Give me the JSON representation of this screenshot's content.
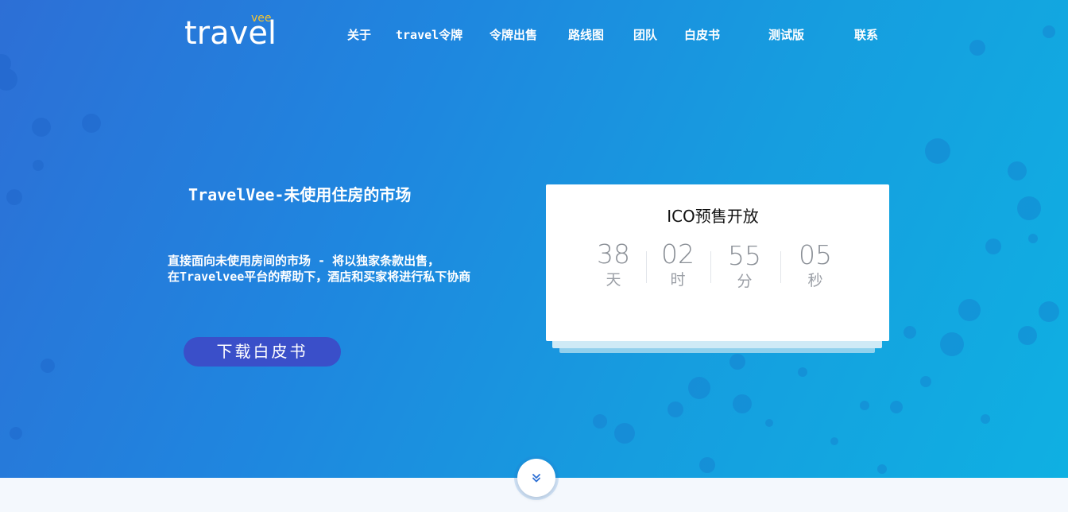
{
  "brand": {
    "logo_main": "travel",
    "logo_sub": "vee"
  },
  "nav": {
    "items": [
      {
        "label": "关于"
      },
      {
        "label": "travel令牌"
      },
      {
        "label": "令牌出售"
      },
      {
        "label": "路线图"
      },
      {
        "label": "团队"
      },
      {
        "label": "白皮书"
      },
      {
        "label": "测试版"
      },
      {
        "label": "联系"
      }
    ]
  },
  "hero": {
    "title": "TravelVee-未使用住房的市场",
    "description_line1": "直接面向未使用房间的市场 - 将以独家条款出售，",
    "description_line2": "在Travelvee平台的帮助下，酒店和买家将进行私下协商",
    "cta_label": "下载白皮书"
  },
  "countdown": {
    "title": "ICO预售开放",
    "days": "38",
    "days_label": "天",
    "hours": "02",
    "hours_label": "时",
    "minutes": "55",
    "minutes_label": "分",
    "seconds": "05",
    "seconds_label": "秒"
  },
  "icons": {
    "scroll": "double-chevron-down-icon"
  },
  "colors": {
    "hero_gradient_start": "#2d6fd6",
    "hero_gradient_end": "#0fb0e2",
    "cta": "#3a4fc9",
    "logo_accent": "#f5c330",
    "page_bg": "#f4f8fd"
  }
}
